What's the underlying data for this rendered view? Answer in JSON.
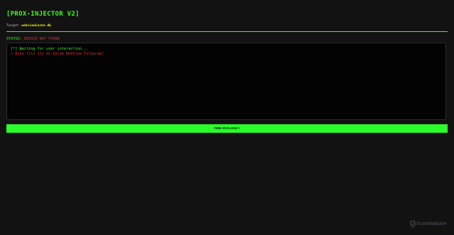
{
  "header": {
    "title": "[PROX-INJECTOR V2]",
    "target_label": "Target:",
    "target_value": "webviewCache.db"
  },
  "status": {
    "label": "STATUS:",
    "value": "BRIDGE NOT FOUND"
  },
  "console": {
    "lines": [
      "[*] Waiting for user interaction...",
      "> Buka file ini di dalam WebView Telegram!"
    ]
  },
  "actions": {
    "fire_label": "FIRE PAYLOAD !"
  },
  "watermark": {
    "text": "ScanMalware",
    "icon": "scanmalware-logo-icon"
  },
  "colors": {
    "accent": "#39ff14",
    "error": "#e0262c",
    "target": "#f2f200",
    "background": "#121212",
    "console_bg": "#030303"
  }
}
